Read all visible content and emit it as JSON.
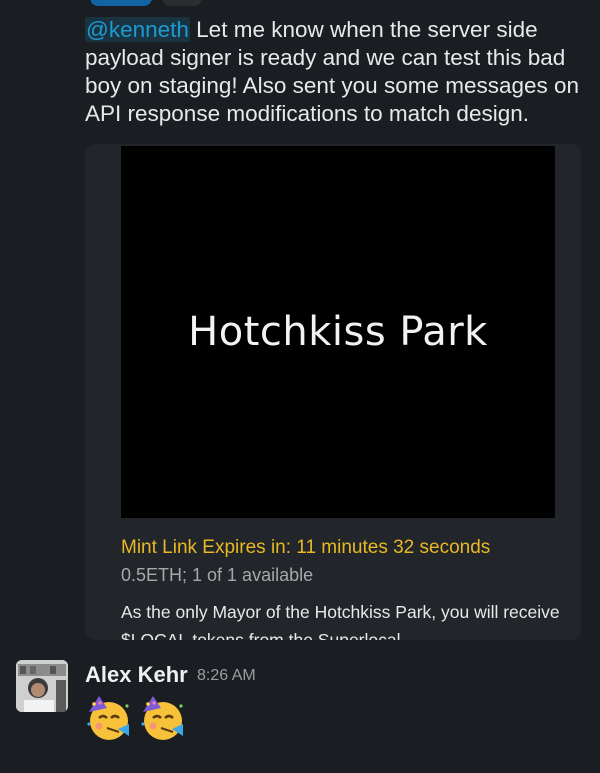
{
  "message": {
    "mention": "@kenneth",
    "text": " Let me know when the server side payload signer is ready and we can test this bad boy on staging!  Also sent you some messages on API response modifications to match design."
  },
  "unfurl": {
    "image_title": "Hotchkiss Park",
    "mint_expires": "Mint Link Expires in: 11 minutes 32 seconds",
    "price_availability": "0.5ETH; 1 of 1 available",
    "description": "As the only Mayor of the Hotchkiss Park, you will receive $LOCAL tokens from the Superlocal"
  },
  "next_message": {
    "sender": "Alex Kehr",
    "timestamp": "8:26 AM",
    "emojis": [
      "partying-face-emoji",
      "partying-face-emoji"
    ]
  },
  "colors": {
    "background": "#1a1d21",
    "mention": "#1d9bd1",
    "mint_expires": "#e8b923",
    "unfurl_bg": "#222529"
  }
}
